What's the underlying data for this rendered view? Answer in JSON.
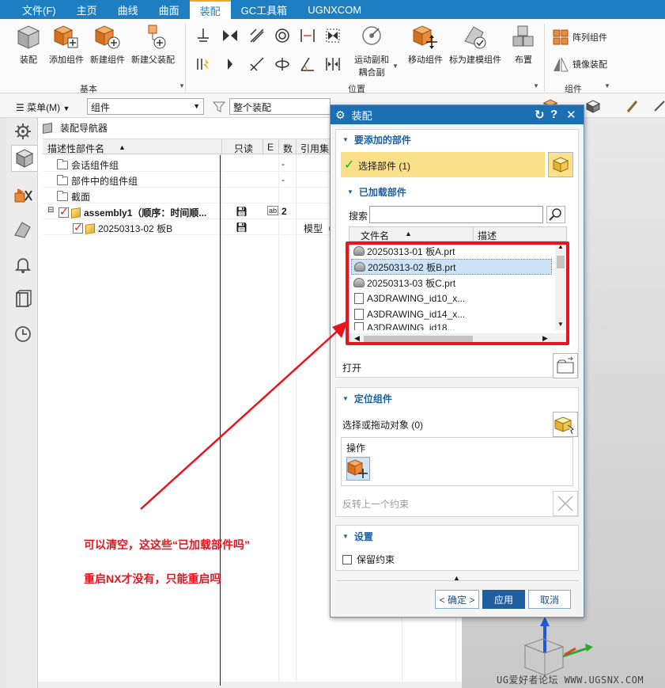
{
  "menubar": {
    "items": [
      "文件(F)",
      "主页",
      "曲线",
      "曲面",
      "装配",
      "GC工具箱",
      "UGNXCOM"
    ],
    "active_index": 4
  },
  "ribbon": {
    "basic_buttons": [
      "装配",
      "添加组件",
      "新建组件",
      "新建父装配"
    ],
    "basic_group_label": "基本",
    "position_buttons": [
      "运动副和耦合副",
      "移动组件",
      "标为建模组件",
      "布置"
    ],
    "motion_label_line1": "运动副和",
    "motion_label_line2": "耦合副",
    "position_group_label": "位置",
    "component_buttons": [
      "阵列组件",
      "镜像装配"
    ],
    "component_group_label": "组件"
  },
  "toolbar2": {
    "menu_label": "菜单(M)",
    "filter_combo": "组件",
    "scope_combo": "整个装配"
  },
  "navigator": {
    "title": "装配导航器",
    "columns": [
      "描述性部件名",
      "只读",
      "E",
      "数",
      "引用集"
    ],
    "rows": [
      {
        "name": "会话组件组",
        "count": "-"
      },
      {
        "name": "部件中的组件组",
        "count": "-"
      },
      {
        "name": "截面",
        "count": ""
      },
      {
        "name": "assembly1（顺序：时间顺...",
        "count": "2",
        "flag": "ab"
      },
      {
        "name": "20250313-02 板B",
        "refset": "模型（\""
      }
    ]
  },
  "dialog": {
    "title": "装配",
    "section_add": "要添加的部件",
    "select_part": "选择部件 (1)",
    "section_loaded": "已加载部件",
    "search_label": "搜索",
    "search_value": "",
    "list_columns": [
      "文件名",
      "描述"
    ],
    "files": [
      "20250313-01 板A.prt",
      "20250313-02 板B.prt",
      "20250313-03 板C.prt",
      "A3DRAWING_id10_x...",
      "A3DRAWING_id14_x...",
      "A3DRAWING_id18..."
    ],
    "selected_file_index": 1,
    "open_label": "打开",
    "section_position": "定位组件",
    "select_drag": "选择或拖动对象 (0)",
    "operation_label": "操作",
    "reverse_label": "反转上一个约束",
    "section_settings": "设置",
    "keep_constraints": "保留约束",
    "btn_ok": "< 确定 >",
    "btn_apply": "应用",
    "btn_cancel": "取消"
  },
  "annotation": {
    "line1": "可以清空，这这些“已加载部件吗”",
    "line2": "重启NX才没有，只能重启吗",
    "color": "#e8141e"
  },
  "watermark": "UG爱好者论坛 WWW.UGSNX.COM"
}
